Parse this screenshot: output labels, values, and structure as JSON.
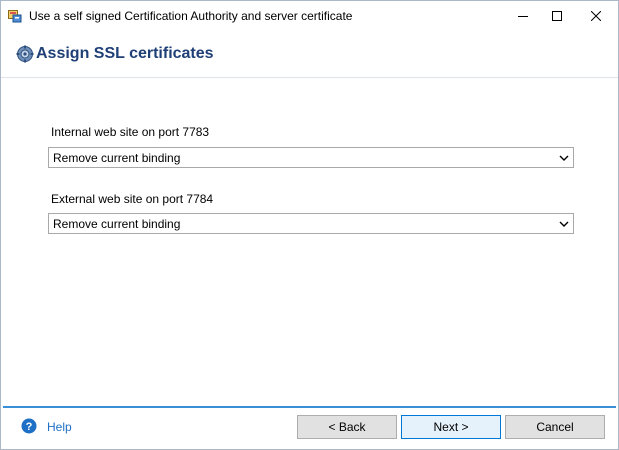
{
  "window": {
    "title": "Use a self signed Certification Authority and server certificate"
  },
  "header": {
    "title": "Assign SSL certificates",
    "icon": "gear-icon"
  },
  "fields": [
    {
      "label": "Internal web site on port 7783",
      "selected": "Remove current binding"
    },
    {
      "label": "External web site on port 7784",
      "selected": "Remove current binding"
    }
  ],
  "footer": {
    "help_label": "Help",
    "back_label": "<  Back",
    "next_label": "Next  >",
    "cancel_label": "Cancel"
  },
  "colors": {
    "header_title": "#1f3f77",
    "footer_accent": "#3a8fd8",
    "link": "#1e6fc6"
  }
}
